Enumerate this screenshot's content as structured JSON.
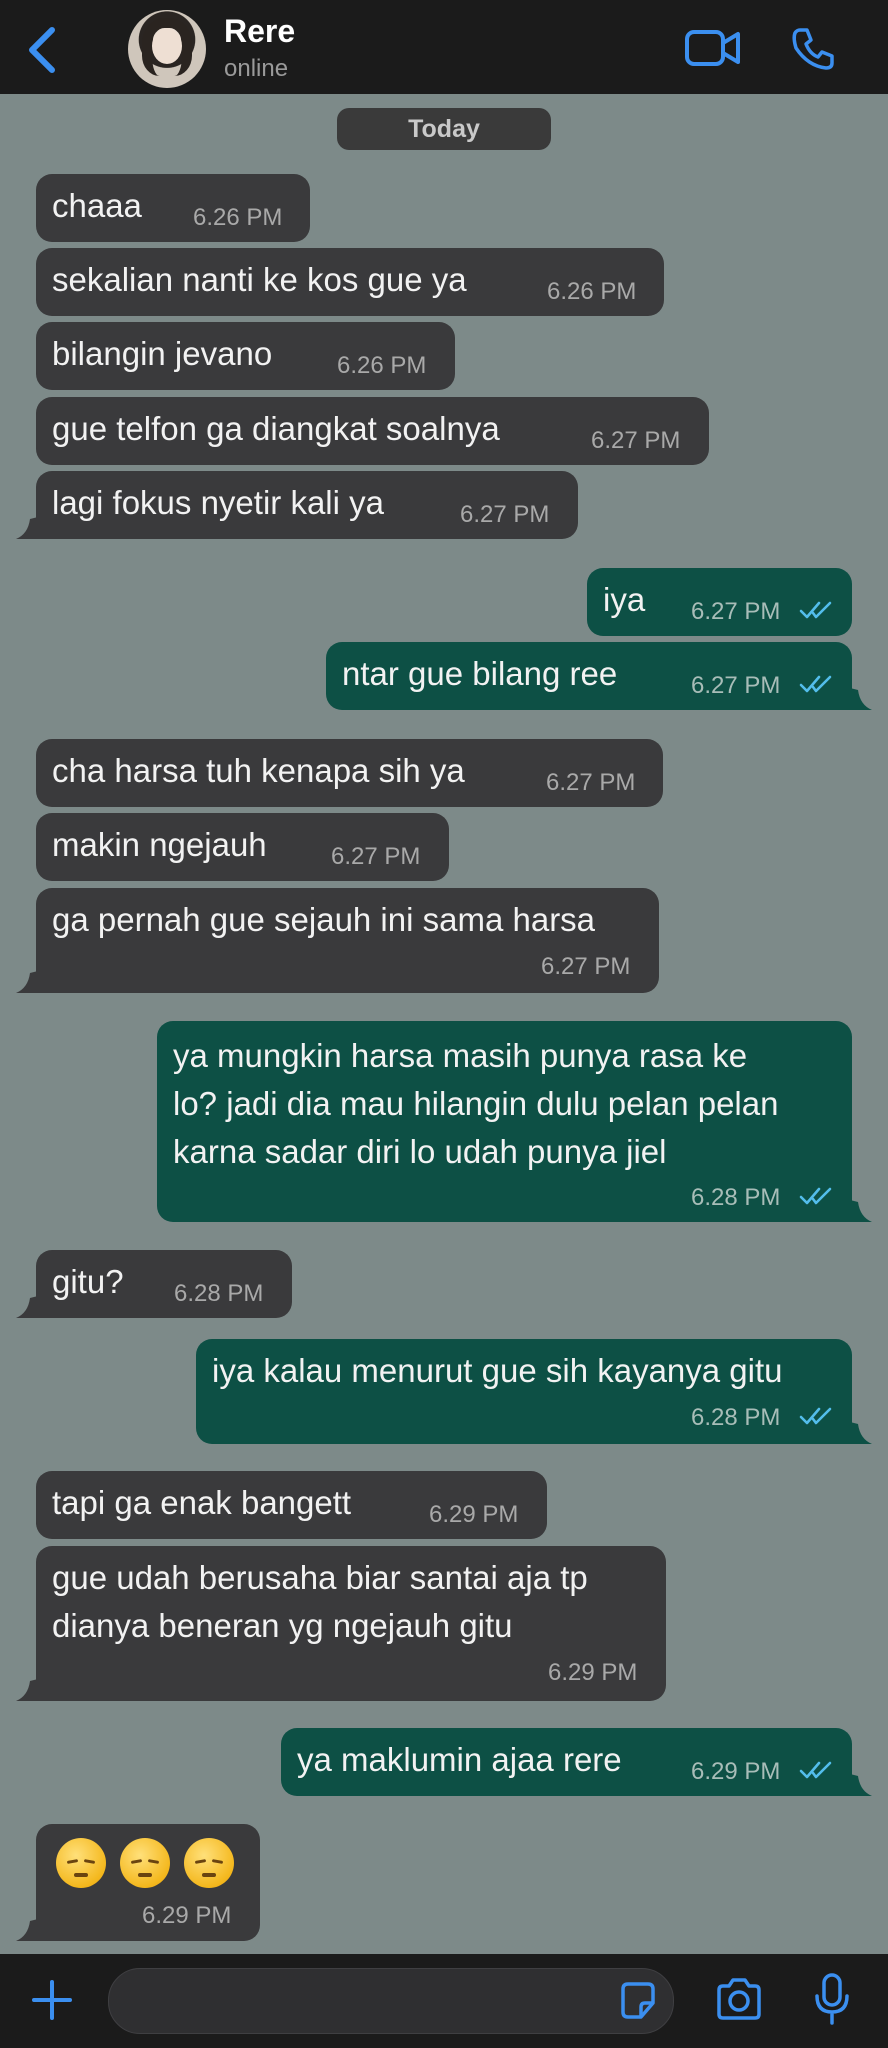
{
  "contact": {
    "name": "Rere",
    "status": "online"
  },
  "date_separator": "Today",
  "messages": [
    {
      "text": "chaaa",
      "time": "6.26 PM"
    },
    {
      "text": "sekalian nanti ke kos gue ya",
      "time": "6.26 PM"
    },
    {
      "text": "bilangin jevano",
      "time": "6.26 PM"
    },
    {
      "text": "gue telfon ga diangkat soalnya",
      "time": "6.27 PM"
    },
    {
      "text": "lagi fokus nyetir kali ya",
      "time": "6.27 PM"
    },
    {
      "text": "iya",
      "time": "6.27 PM"
    },
    {
      "text": "ntar gue bilang ree",
      "time": "6.27 PM"
    },
    {
      "text": "cha harsa tuh kenapa sih ya",
      "time": "6.27 PM"
    },
    {
      "text": "makin ngejauh",
      "time": "6.27 PM"
    },
    {
      "text": "ga pernah gue sejauh ini sama harsa",
      "time": "6.27 PM"
    },
    {
      "lines": [
        "ya mungkin harsa masih punya rasa ke",
        "lo? jadi dia mau hilangin dulu pelan pelan",
        "karna sadar diri lo udah punya jiel"
      ],
      "time": "6.28 PM"
    },
    {
      "text": "gitu?",
      "time": "6.28 PM"
    },
    {
      "text": "iya kalau menurut gue sih kayanya gitu",
      "time": "6.28 PM"
    },
    {
      "text": "tapi ga enak bangett",
      "time": "6.29 PM"
    },
    {
      "lines": [
        "gue udah berusaha biar santai aja tp",
        "dianya beneran yg ngejauh gitu"
      ],
      "time": "6.29 PM"
    },
    {
      "text": "ya maklumin ajaa rere",
      "time": "6.29 PM"
    },
    {
      "emoji": "pensive-face x3",
      "time": "6.29 PM"
    }
  ],
  "colors": {
    "background": "#7d8a89",
    "incoming_bubble": "#3a3a3c",
    "outgoing_bubble": "#0d5045",
    "accent": "#3b8ff0",
    "read_ticks": "#53bdeb"
  }
}
